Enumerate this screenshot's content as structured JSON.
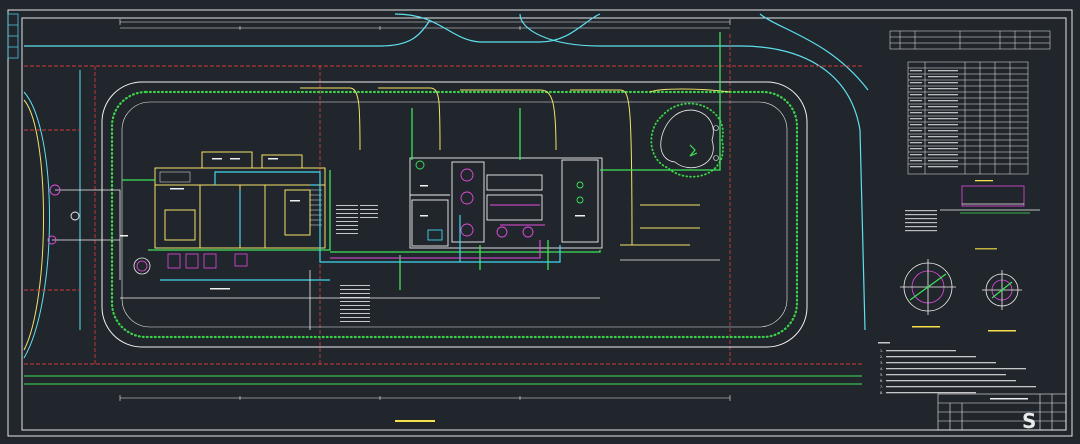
{
  "drawing": {
    "title": "",
    "scale_note": "",
    "watermark": "S"
  },
  "plan": {
    "areas": [
      {
        "key": "a1",
        "label": ""
      },
      {
        "key": "a2",
        "label": ""
      },
      {
        "key": "a3",
        "label": ""
      },
      {
        "key": "a4",
        "label": ""
      }
    ]
  },
  "details": {
    "section_a": "",
    "detail_1": "",
    "detail_2": ""
  },
  "notes": {
    "heading": "",
    "lines": [
      "1.",
      "2.",
      "3.",
      "4.",
      "5.",
      "6.",
      "7.",
      "8."
    ]
  },
  "colors": {
    "background": "#20262b",
    "frame": "#e6e6e6",
    "road": "#5fe0f0",
    "boundary": "#d03b3b",
    "building": "#f3e36a",
    "pipe_green": "#3fe35a",
    "pipe_cyan": "#41d8f0",
    "pipe_magenta": "#e44ce0",
    "planting": "#3cd24a"
  }
}
